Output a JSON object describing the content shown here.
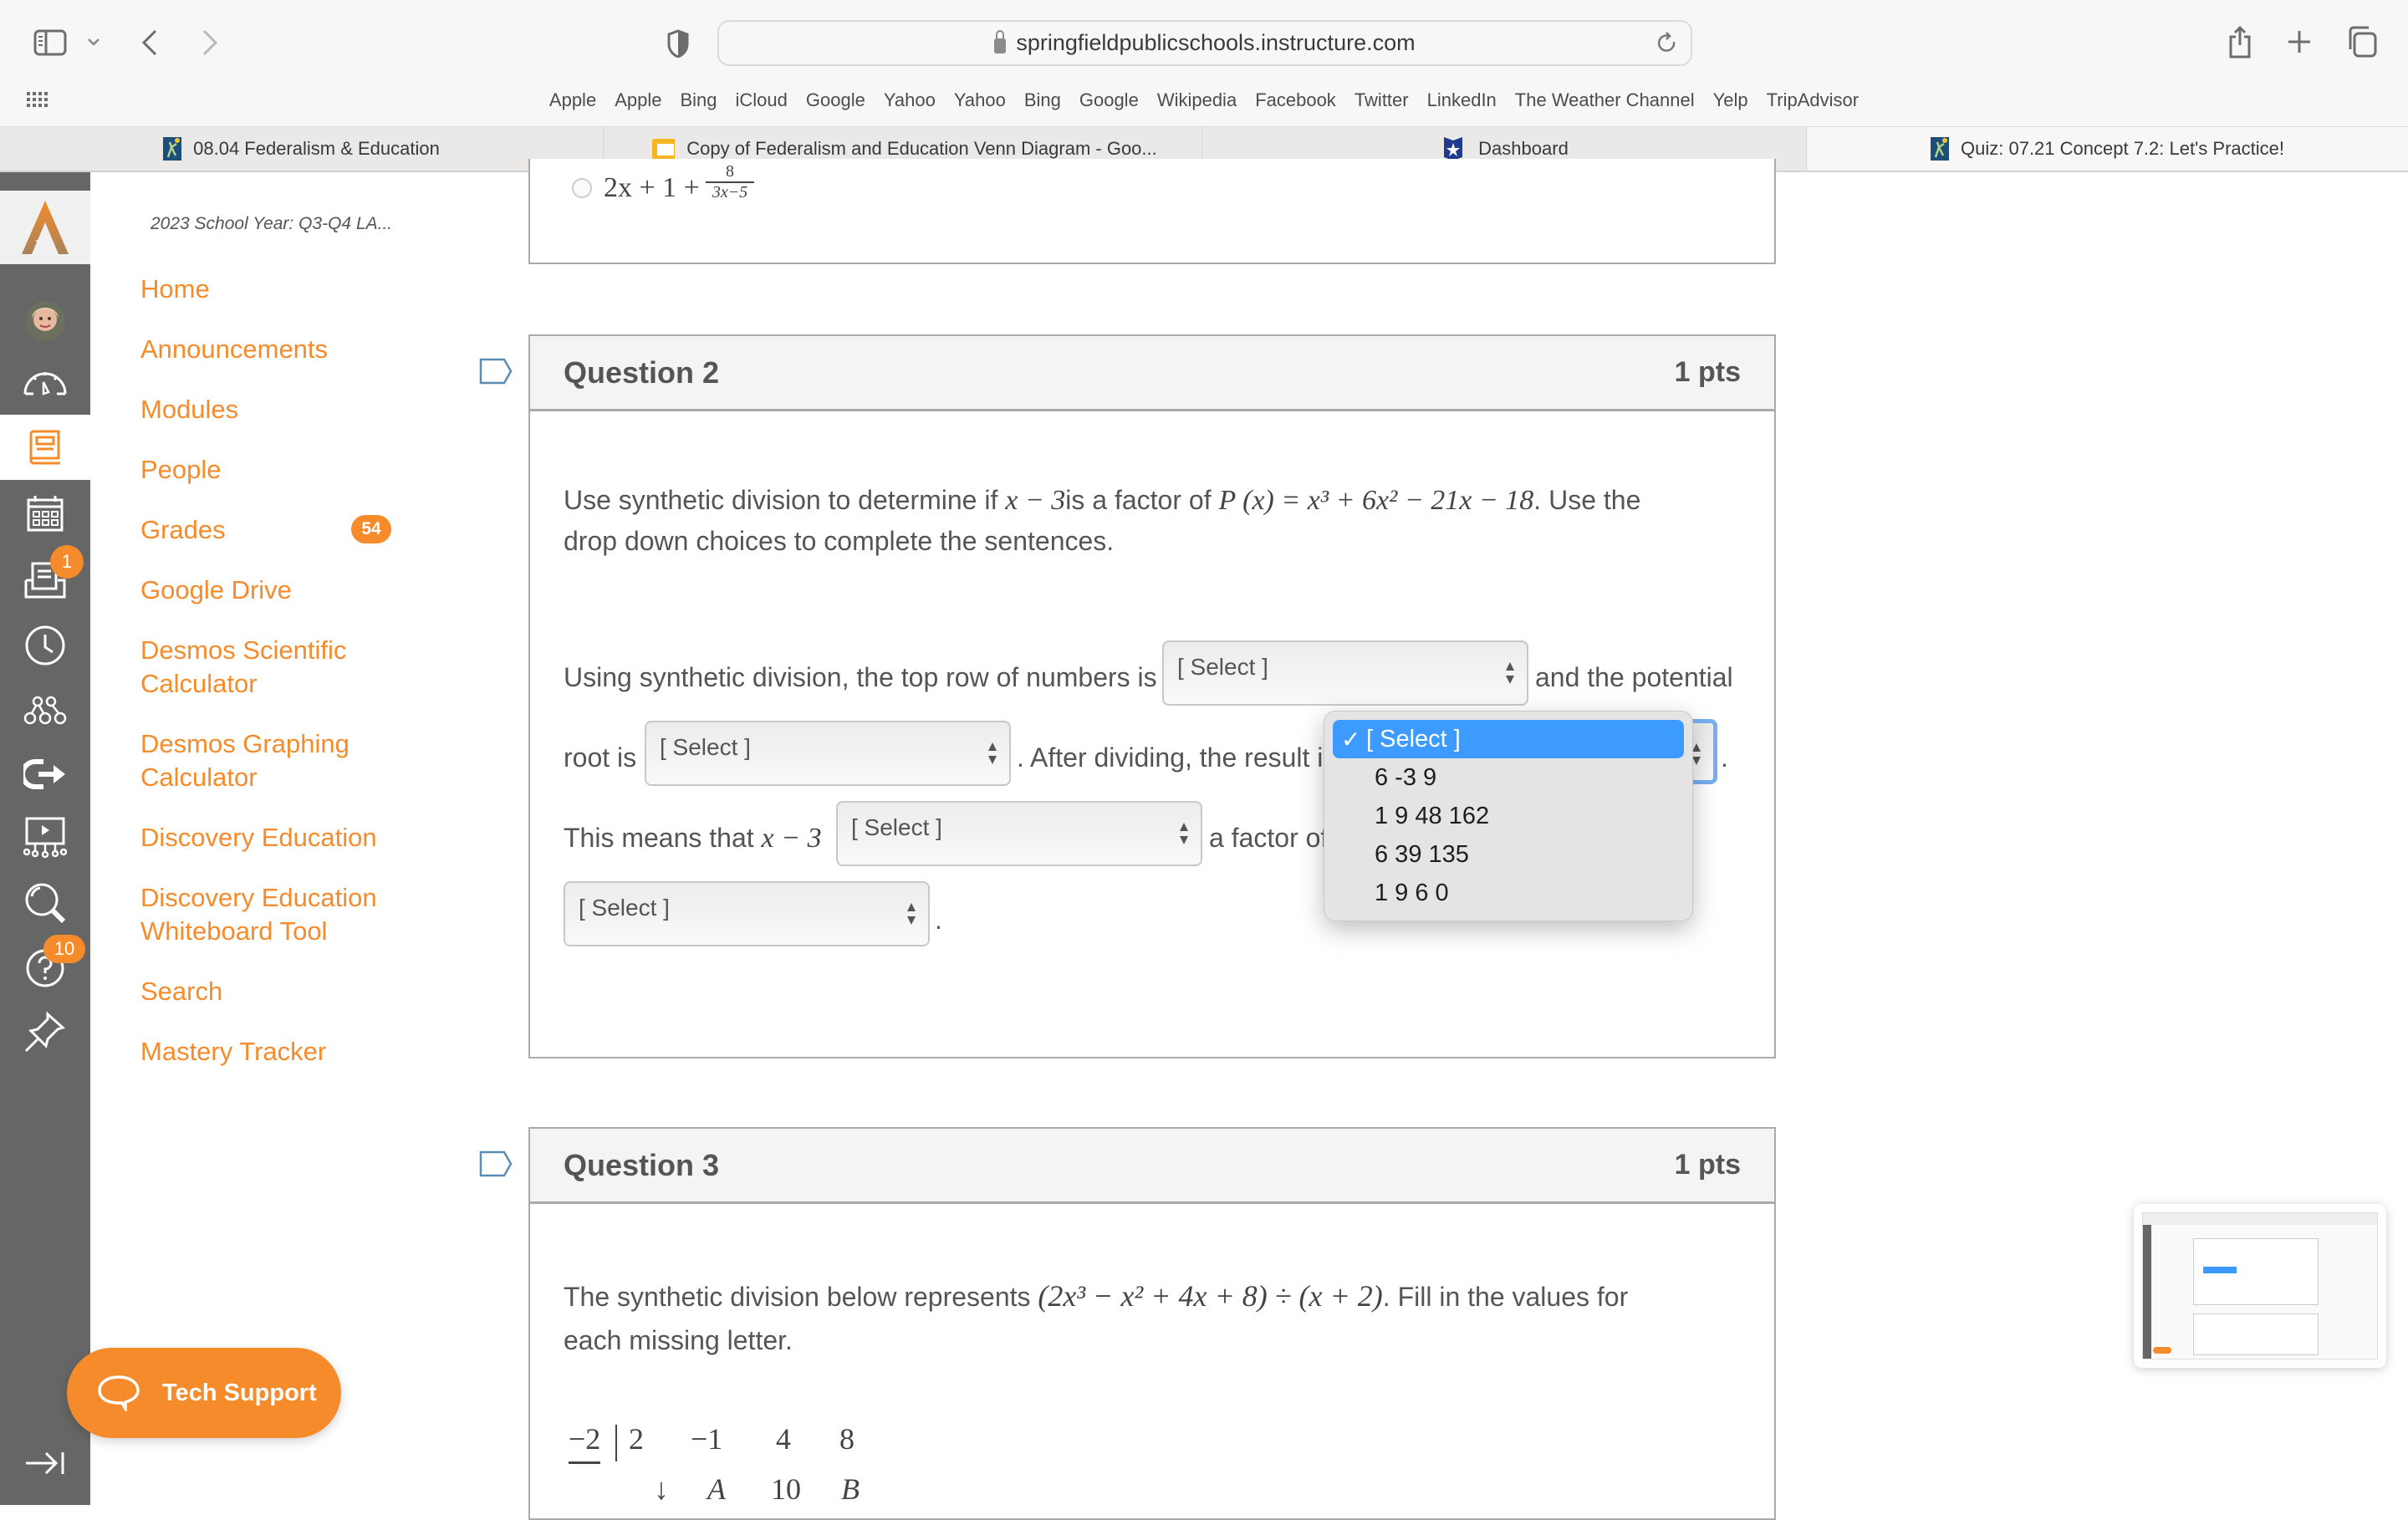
{
  "browser": {
    "url": "springfieldpublicschools.instructure.com",
    "bookmarks": [
      "Apple",
      "Apple",
      "Bing",
      "iCloud",
      "Google",
      "Yahoo",
      "Yahoo",
      "Bing",
      "Google",
      "Wikipedia",
      "Facebook",
      "Twitter",
      "LinkedIn",
      "The Weather Channel",
      "Yelp",
      "TripAdvisor"
    ],
    "tabs": [
      {
        "label": "08.04 Federalism & Education",
        "icon": "school-logo-icon",
        "active": false
      },
      {
        "label": "Copy of Federalism and Education Venn Diagram - Goo...",
        "icon": "google-slides-icon",
        "active": false
      },
      {
        "label": "Dashboard",
        "icon": "star-shield-icon",
        "active": false
      },
      {
        "label": "Quiz: 07.21 Concept 7.2: Let's Practice!",
        "icon": "school-logo-icon",
        "active": true
      }
    ]
  },
  "rail": {
    "badges": {
      "inbox": "1",
      "help": "10"
    }
  },
  "course": {
    "title": "2023 School Year: Q3-Q4 LA...",
    "nav": [
      {
        "label": "Home"
      },
      {
        "label": "Announcements"
      },
      {
        "label": "Modules"
      },
      {
        "label": "People"
      },
      {
        "label": "Grades",
        "badge": "54"
      },
      {
        "label": "Google Drive"
      },
      {
        "label": "Desmos Scientific Calculator",
        "line1": "Desmos Scientific",
        "line2": "Calculator"
      },
      {
        "label": "Desmos Graphing Calculator",
        "line1": "Desmos Graphing",
        "line2": "Calculator"
      },
      {
        "label": "Discovery Education"
      },
      {
        "label": "Discovery Education Whiteboard Tool",
        "line1": "Discovery Education",
        "line2": "Whiteboard Tool"
      },
      {
        "label": "Search"
      },
      {
        "label": "Mastery Tracker"
      }
    ]
  },
  "quiz": {
    "prev_answer": {
      "text": "2x + 1 +",
      "num": "8",
      "den": "3x−5"
    },
    "q2": {
      "title": "Question 2",
      "points": "1 pts",
      "prompt_a": "Use synthetic division to determine if ",
      "prompt_math1": "x − 3",
      "prompt_b": "is a factor of ",
      "prompt_math2": "P (x) = x³ + 6x² − 21x − 18",
      "prompt_c": ". Use the",
      "prompt_line2": "drop down choices to complete the sentences.",
      "s1_a": "Using synthetic division, the top row of numbers is",
      "s1_b": "and the potential",
      "s2_a": "root is",
      "s2_b": ". After dividing, the result i",
      "s2_c": ".",
      "s3_a": "This means that",
      "s3_math": "x − 3",
      "s3_b": "a factor of",
      "s4_end": ".",
      "select_placeholder": "[ Select ]"
    },
    "dropdown": {
      "options": [
        "[ Select ]",
        "6 -3 9",
        "1 9 48 162",
        "6 39 135",
        "1 9 6 0"
      ],
      "selected_index": 0,
      "check": "✓"
    },
    "q3": {
      "title": "Question 3",
      "points": "1 pts",
      "prompt_a": "The synthetic division below represents ",
      "prompt_math": "(2x³ − x² + 4x + 8) ÷ (x + 2)",
      "prompt_b": ".  Fill in the values for",
      "prompt_line2": "each missing letter.",
      "divisor": "−2",
      "row1": [
        "2",
        "−1",
        "4",
        "8"
      ],
      "row2": [
        "↓",
        "A",
        "10",
        "B"
      ]
    }
  },
  "tech_support": {
    "label": "Tech Support"
  }
}
